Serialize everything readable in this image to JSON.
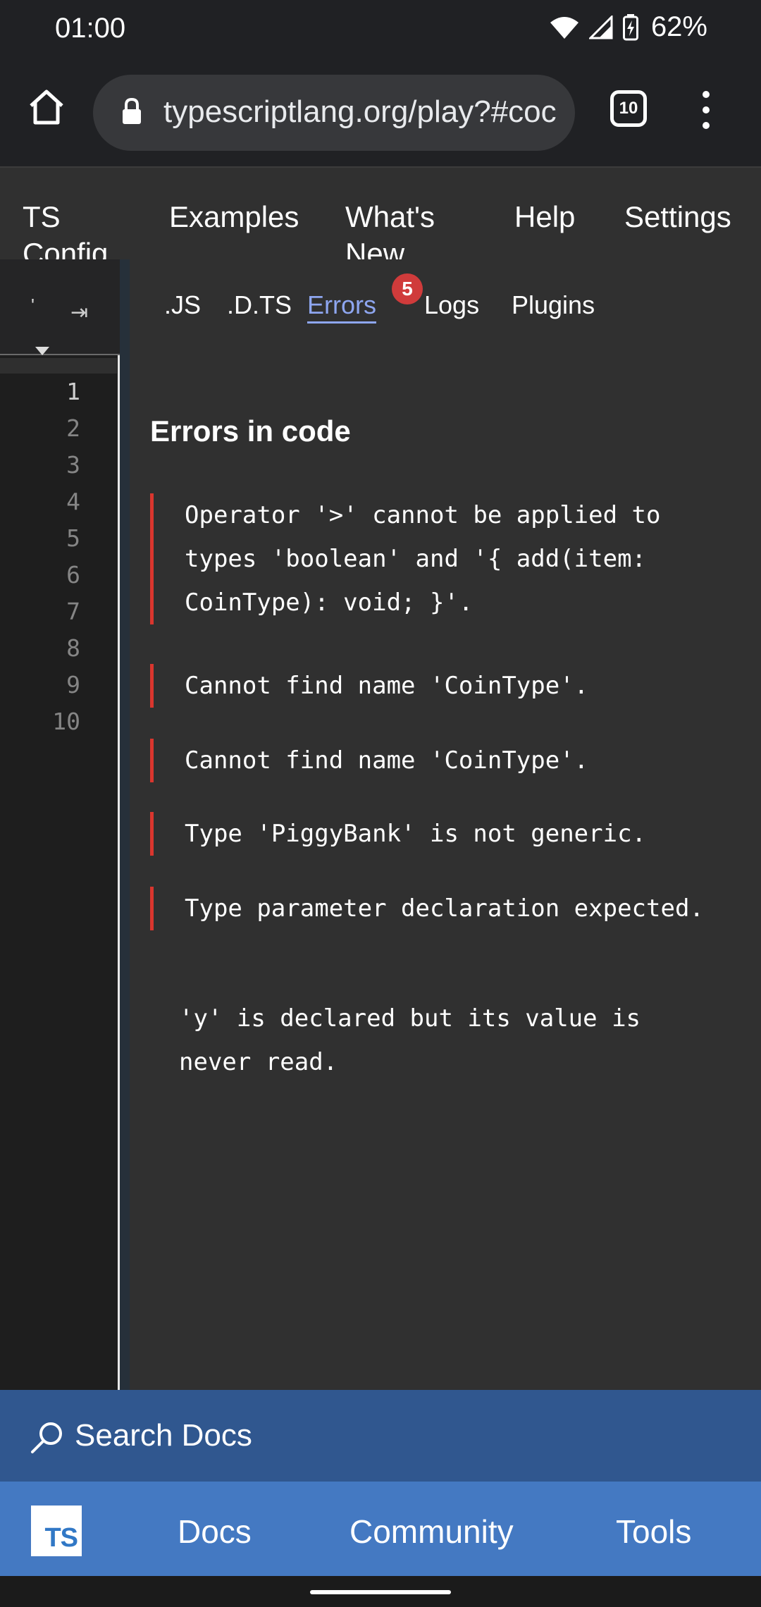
{
  "status_bar": {
    "time": "01:00",
    "battery_percent": "62%"
  },
  "browser": {
    "url": "typescriptlang.org/play?#coc",
    "tab_count": "10"
  },
  "site_nav": {
    "items": [
      "TS Config",
      "Examples",
      "What's New",
      "Help",
      "Settings"
    ]
  },
  "editor": {
    "line_numbers": [
      "1",
      "2",
      "3",
      "4",
      "5",
      "6",
      "7",
      "8",
      "9",
      "10"
    ],
    "header_mark": "'",
    "header_arrow": "⇥"
  },
  "output_tabs": {
    "items": [
      ".JS",
      ".D.TS",
      "Errors",
      "Logs",
      "Plugins"
    ],
    "active": "Errors",
    "error_count": "5"
  },
  "errors_panel": {
    "title": "Errors in code",
    "errors": [
      "Operator '>' cannot be applied to types 'boolean' and '{ add(item: CoinType): void; }'.",
      "Cannot find name 'CoinType'.",
      "Cannot find name 'CoinType'.",
      "Type 'PiggyBank' is not generic.",
      "Type parameter declaration expected.",
      "'y' is declared but its value is never read."
    ]
  },
  "search": {
    "label": "Search Docs"
  },
  "bottom_nav": {
    "logo": "TS",
    "items": [
      "Docs",
      "Community",
      "Tools"
    ]
  },
  "colors": {
    "accent": "#8ea6f0",
    "error": "#d9362e",
    "brand": "#3178c6"
  }
}
